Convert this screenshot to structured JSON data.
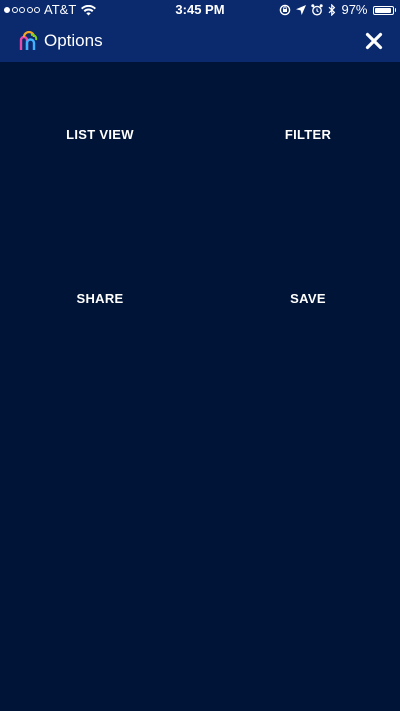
{
  "status_bar": {
    "carrier": "AT&T",
    "time": "3:45 PM",
    "battery_percent": "97%",
    "battery_level": 0.97,
    "signal_strength": 1,
    "icons": [
      "wifi-icon",
      "lock-rotation-icon",
      "location-arrow-icon",
      "alarm-icon",
      "bluetooth-icon",
      "battery-icon"
    ]
  },
  "header": {
    "title": "Options",
    "logo_icon": "app-logo-icon",
    "close_icon": "close-icon"
  },
  "options": {
    "list_view": "LIST VIEW",
    "filter": "FILTER",
    "share": "SHARE",
    "save": "SAVE"
  },
  "colors": {
    "background": "#001437",
    "header": "#0b2a6e",
    "text": "#ffffff"
  }
}
